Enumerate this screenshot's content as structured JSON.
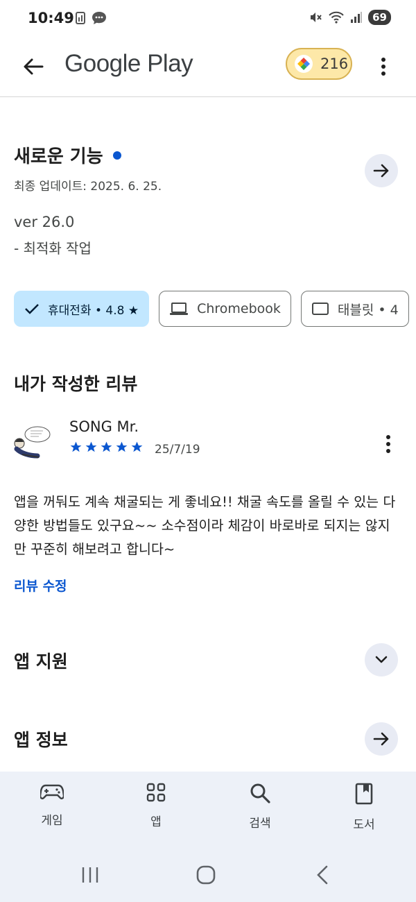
{
  "status_bar": {
    "time": "10:49",
    "battery": "69"
  },
  "app_bar": {
    "title": "Google Play",
    "points": "216"
  },
  "whats_new": {
    "title": "새로운 기능",
    "last_updated": "최종 업데이트: 2025. 6. 25.",
    "version": "ver 26.0",
    "notes": "- 최적화 작업"
  },
  "device_chips": [
    {
      "label": "휴대전화 • 4.8 ★",
      "selected": true,
      "icon": "check-icon"
    },
    {
      "label": "Chromebook",
      "selected": false,
      "icon": "laptop-icon"
    },
    {
      "label": "태블릿 • 4",
      "selected": false,
      "icon": "tablet-icon"
    }
  ],
  "my_review": {
    "header": "내가 작성한 리뷰",
    "reviewer": "SONG Mr.",
    "rating": 5,
    "date": "25/7/19",
    "text": "앱을 꺼둬도 계속 채굴되는 게 좋네요!! 채굴 속도를 올릴 수 있는 다양한 방법들도 있구요~~ 소수점이라 체감이 바로바로 되지는 않지만 꾸준히 해보려고 합니다~",
    "edit_label": "리뷰 수정"
  },
  "sections": {
    "app_support": "앱 지원",
    "app_info": "앱 정보"
  },
  "bottom_nav": [
    {
      "label": "게임",
      "icon": "gamepad-icon"
    },
    {
      "label": "앱",
      "icon": "apps-grid-icon"
    },
    {
      "label": "검색",
      "icon": "search-icon"
    },
    {
      "label": "도서",
      "icon": "book-icon"
    }
  ],
  "colors": {
    "accent": "#0b57d0",
    "chip_selected": "#c2e7ff",
    "nav_bg": "#edf1f8",
    "points_bg": "#fde8a8"
  }
}
